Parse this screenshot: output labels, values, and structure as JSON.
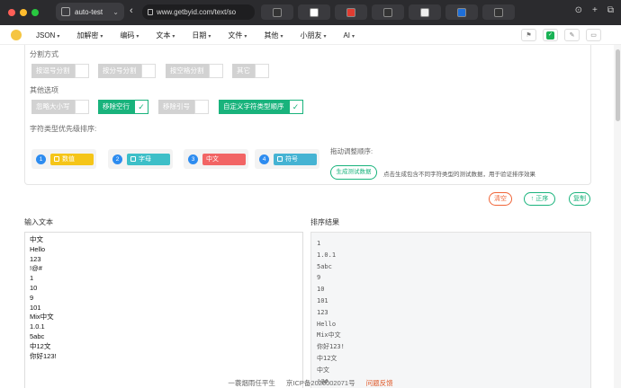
{
  "browser": {
    "tab_title": "auto-test",
    "url": "www.getbyid.com/text/so",
    "window_controls": [
      "#ff5f57",
      "#febc2e",
      "#28c840"
    ],
    "mini_tabs": [
      {
        "icon": "terminal-icon",
        "color": "#333333"
      },
      {
        "icon": "chat-icon",
        "color": "#ffffff"
      },
      {
        "icon": "target-icon",
        "color": "#e03c31"
      },
      {
        "icon": "terminal-icon",
        "color": "#333333"
      },
      {
        "icon": "image-icon",
        "color": "#eeeeee"
      },
      {
        "icon": "cloud-icon",
        "color": "#1e6fd9"
      },
      {
        "icon": "terminal-icon",
        "color": "#333333"
      }
    ],
    "right_icons": [
      "download-icon",
      "plus-icon",
      "copy-icon"
    ]
  },
  "nav": {
    "logo_icon": "emoji-logo-icon",
    "items": [
      {
        "label": "JSON"
      },
      {
        "label": "加解密"
      },
      {
        "label": "编码"
      },
      {
        "label": "文本"
      },
      {
        "label": "日期"
      },
      {
        "label": "文件"
      },
      {
        "label": "其他"
      },
      {
        "label": "小朋友"
      },
      {
        "label": "AI"
      }
    ],
    "right_icons": [
      "flag-icon",
      "check-icon",
      "pin-icon",
      "folder-icon"
    ]
  },
  "options": {
    "split_label": "分割方式",
    "split": [
      "按逗号分割",
      "按分号分割",
      "按空格分割",
      "其它"
    ],
    "other_label": "其他选项",
    "other": [
      {
        "label": "忽略大小写",
        "on": false
      },
      {
        "label": "移除空行",
        "on": true
      },
      {
        "label": "移除引号",
        "on": false
      },
      {
        "label": "自定义字符类型顺序",
        "on": true
      }
    ],
    "priority_label": "字符类型优先级排序:",
    "types": [
      {
        "num": "1",
        "label": "数值",
        "color": "#f5c518",
        "icon": "grid-icon"
      },
      {
        "num": "2",
        "label": "字母",
        "color": "#3dbfc8",
        "icon": "doc-icon"
      },
      {
        "num": "3",
        "label": "中文",
        "color": "#f26565",
        "icon": ""
      },
      {
        "num": "4",
        "label": "符号",
        "color": "#45b3d3",
        "icon": "pencil-icon"
      }
    ],
    "drag_tip": "拖动调整顺序:",
    "gen_btn": "生成测试数据",
    "gen_tip": "点击生成包含不同字符类型的测试数据，用于验证排序效果"
  },
  "actions": {
    "clear": "清空",
    "asc": "↑ 正序",
    "copy": "复制"
  },
  "input": {
    "label": "输入文本",
    "lines": [
      "中文",
      "Hello",
      "123",
      "!@#",
      "1",
      "10",
      "9",
      "101",
      "Mix中文",
      "1.0.1",
      "5abc",
      "中12文",
      "你好123!"
    ]
  },
  "output": {
    "label": "排序结果",
    "lines": [
      "1",
      "1.0.1",
      "5abc",
      "9",
      "10",
      "101",
      "123",
      "Hello",
      "Mix中文",
      "你好123!",
      "中12文",
      "中文",
      "!@#"
    ]
  },
  "footer": {
    "author": "一蓑烟雨任平生",
    "icp": "京ICP备2026002071号",
    "report": "问题反馈"
  }
}
